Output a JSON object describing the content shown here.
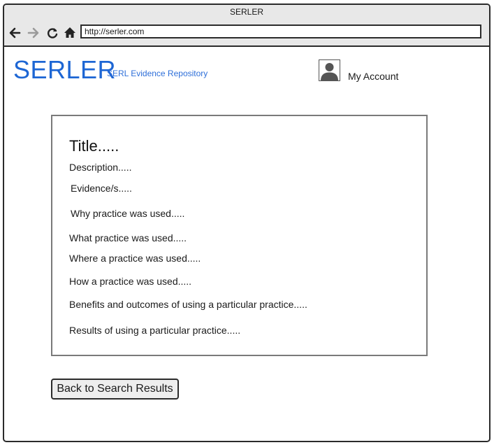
{
  "window": {
    "title": "SERLER"
  },
  "browser": {
    "url": "http://serler.com",
    "icons": [
      "back-arrow-icon",
      "forward-arrow-icon",
      "reload-icon",
      "home-icon"
    ]
  },
  "header": {
    "brand": "SERLER",
    "tagline": "SERL Evidence Repository",
    "account_label": "My Account",
    "avatar_icon": "user-avatar-icon"
  },
  "practice": {
    "title": "Title.....",
    "fields": {
      "description": "Description.....",
      "evidence": "Evidence/s.....",
      "why": "Why practice was used.....",
      "what": "What practice was used.....",
      "where": "Where a practice was used.....",
      "how": "How a practice was used.....",
      "benefits": "Benefits and outcomes of using a particular practice.....",
      "results": "Results of using a particular practice....."
    }
  },
  "actions": {
    "back_label": "Back to Search Results"
  },
  "colors": {
    "brand": "#1d66d4",
    "chrome": "#e8e8e8",
    "border": "#2b2b2b"
  }
}
